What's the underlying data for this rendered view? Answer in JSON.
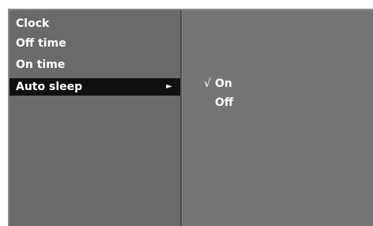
{
  "menu": {
    "items": [
      {
        "label": "Clock"
      },
      {
        "label": "Off time"
      },
      {
        "label": "On time"
      },
      {
        "label": "Auto sleep",
        "arrow": "►"
      }
    ]
  },
  "submenu": {
    "options": [
      {
        "check": "√",
        "label": "On",
        "checked": true
      },
      {
        "check": "",
        "label": "Off",
        "checked": false
      }
    ]
  },
  "colors": {
    "panel": "#6f6f6f",
    "selected": "#101010",
    "text": "#ffffff"
  }
}
